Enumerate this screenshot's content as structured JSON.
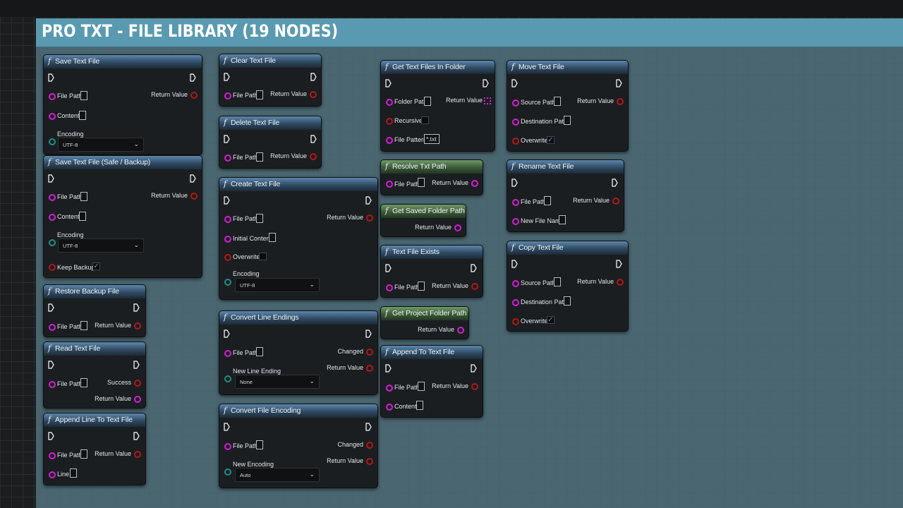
{
  "comment": {
    "title": "PRO TXT - FILE LIBRARY (19 NODES)"
  },
  "labels": {
    "func_icon": "f",
    "file_path": "File Path",
    "content": "Content",
    "encoding": "Encoding",
    "return_value": "Return Value",
    "keep_backup": "Keep Backup",
    "initial_content": "Initial Content",
    "overwrite": "Overwrite",
    "success": "Success",
    "line": "Line",
    "changed": "Changed",
    "new_line_ending": "New Line Ending",
    "new_encoding": "New Encoding",
    "folder_path": "Folder Path",
    "recursive": "Recursive",
    "file_pattern": "File Pattern",
    "source_path": "Source Path",
    "destination_path": "Destination Path",
    "new_file_name": "New File Name"
  },
  "nodes": {
    "save_text_file": {
      "title": "Save Text File",
      "encoding_value": "UTF-8"
    },
    "save_text_file_safe": {
      "title": "Save Text File (Safe / Backup)",
      "encoding_value": "UTF-8",
      "keep_backup": true
    },
    "restore_backup_file": {
      "title": "Restore Backup File"
    },
    "read_text_file": {
      "title": "Read Text File"
    },
    "append_line_to_text_file": {
      "title": "Append Line To Text File"
    },
    "clear_text_file": {
      "title": "Clear Text File"
    },
    "delete_text_file": {
      "title": "Delete Text File"
    },
    "create_text_file": {
      "title": "Create Text File",
      "encoding_value": "UTF-8",
      "overwrite": false
    },
    "convert_line_endings": {
      "title": "Convert Line Endings",
      "line_ending_value": "None"
    },
    "convert_file_encoding": {
      "title": "Convert File Encoding",
      "encoding_value": "Auto"
    },
    "get_text_files_in_folder": {
      "title": "Get Text Files In Folder",
      "file_pattern_value": "*.txt",
      "recursive": false
    },
    "resolve_txt_path": {
      "title": "Resolve Txt Path"
    },
    "get_saved_folder_path": {
      "title": "Get Saved Folder Path"
    },
    "text_file_exists": {
      "title": "Text File Exists"
    },
    "get_project_folder_path": {
      "title": "Get Project Folder Path"
    },
    "append_to_text_file": {
      "title": "Append To Text File"
    },
    "move_text_file": {
      "title": "Move Text File",
      "overwrite": true
    },
    "rename_text_file": {
      "title": "Rename Text File"
    },
    "copy_text_file": {
      "title": "Copy Text File",
      "overwrite": true
    }
  },
  "colors": {
    "string_pin": "#d21fd2",
    "bool_pin": "#b01818",
    "enum_pin": "#1f8f85",
    "comment_header": "#5a9ab0",
    "comment_body": "#4a6670",
    "impure_header": "#2f4a62",
    "pure_header": "#3c5a38"
  },
  "icons": [
    "function-icon",
    "exec-pin-icon",
    "data-pin-icon",
    "array-pin-icon",
    "checkbox-check-icon",
    "chevron-down-icon"
  ]
}
